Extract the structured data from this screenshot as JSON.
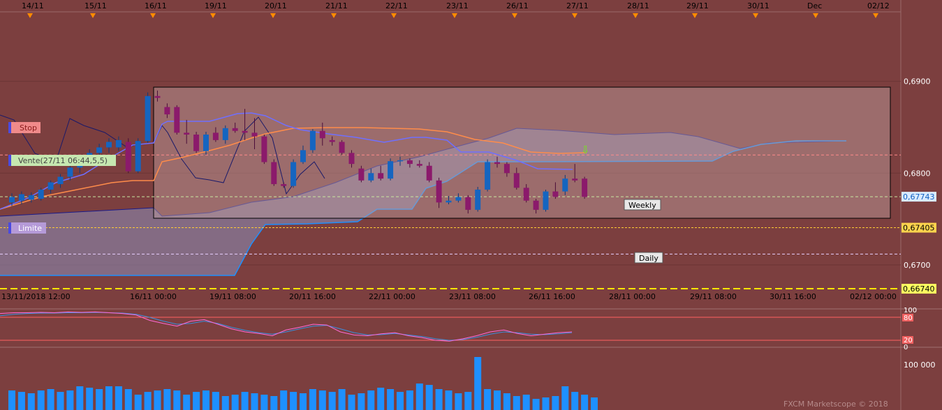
{
  "colors": {
    "background": "#7c3f3f",
    "axis_panel": "#7c3f3f",
    "grid": "#6a3434",
    "bull_candle": "#1565c0",
    "bear_candle": "#8b1a6b",
    "tenkan": "#6f6fff",
    "kijun": "#ff8c4a",
    "senkou_span": "#1e90ff",
    "cloud_fill": "#8a90bb",
    "stop_line": "#ff8a8a",
    "stoch_k": "#ff6ad5",
    "stoch_d": "#3a8fe0",
    "volume": "#1e90ff",
    "weekly_box": "#c4a3a3",
    "yellow_line": "#ffe600"
  },
  "top_dates": [
    "14/11",
    "15/11",
    "16/11",
    "19/11",
    "20/11",
    "21/11",
    "22/11",
    "23/11",
    "26/11",
    "27/11",
    "28/11",
    "29/11",
    "30/11",
    "Dec",
    "02/12"
  ],
  "bottom_dates": [
    "13/11/2018 12:00",
    "16/11 00:00",
    "19/11 08:00",
    "20/11 16:00",
    "22/11 00:00",
    "23/11 08:00",
    "26/11 16:00",
    "28/11 00:00",
    "29/11 08:00",
    "30/11 16:00",
    "02/12 00:00"
  ],
  "price_axis": {
    "ticks": [
      "0,6900",
      "0,6800",
      "0,6700"
    ],
    "tags": [
      {
        "label": "0,67743",
        "value": 0.67743,
        "kind": "current"
      },
      {
        "label": "0,67405",
        "value": 0.67405,
        "kind": "weekly"
      },
      {
        "label": "0,66740",
        "value": 0.6674,
        "kind": "daily"
      }
    ]
  },
  "annotations": {
    "stop": "Stop",
    "vente": "Vente(27/11 06:44,5,5)",
    "limite": "Limite",
    "weekly": "Weekly",
    "daily": "Daily"
  },
  "osc_axis": [
    "100",
    "80",
    "20",
    "0"
  ],
  "vol_axis": [
    "100 000"
  ],
  "watermark": "FXCM Marketscope © 2018",
  "chart_data": {
    "type": "candlestick",
    "ylim": [
      0.6652,
      0.6975
    ],
    "levels": {
      "stop": 0.68198,
      "entry": 0.67743,
      "weekly": 0.67405,
      "limit": 0.67118,
      "daily": 0.6674
    },
    "candles": [
      [
        0.6768,
        0.6774,
        0.6764,
        0.6778
      ],
      [
        0.677,
        0.6777,
        0.6766,
        0.678
      ],
      [
        0.6771,
        0.6776,
        0.6768,
        0.6779
      ],
      [
        0.6772,
        0.6782,
        0.677,
        0.6784
      ],
      [
        0.6782,
        0.679,
        0.6778,
        0.6792
      ],
      [
        0.6788,
        0.6796,
        0.6784,
        0.6799
      ],
      [
        0.6796,
        0.6806,
        0.6792,
        0.681
      ],
      [
        0.6806,
        0.6813,
        0.68,
        0.6816
      ],
      [
        0.6813,
        0.6822,
        0.6808,
        0.6826
      ],
      [
        0.6822,
        0.6828,
        0.6816,
        0.6832
      ],
      [
        0.6828,
        0.6834,
        0.6822,
        0.6838
      ],
      [
        0.6828,
        0.6836,
        0.6824,
        0.684
      ],
      [
        0.6834,
        0.6802,
        0.68,
        0.6838
      ],
      [
        0.6802,
        0.6835,
        0.68,
        0.6838
      ],
      [
        0.6835,
        0.6884,
        0.6833,
        0.6888
      ],
      [
        0.6884,
        0.6882,
        0.6878,
        0.689
      ],
      [
        0.6872,
        0.6864,
        0.686,
        0.6876
      ],
      [
        0.6872,
        0.6844,
        0.6842,
        0.6874
      ],
      [
        0.6844,
        0.6842,
        0.6832,
        0.6858
      ],
      [
        0.6842,
        0.6824,
        0.6822,
        0.6845
      ],
      [
        0.6824,
        0.6842,
        0.682,
        0.6845
      ],
      [
        0.6844,
        0.6836,
        0.6834,
        0.685
      ],
      [
        0.6836,
        0.6849,
        0.6832,
        0.6852
      ],
      [
        0.6849,
        0.6846,
        0.6844,
        0.6855
      ],
      [
        0.6846,
        0.6844,
        0.6836,
        0.687
      ],
      [
        0.6844,
        0.684,
        0.6826,
        0.686
      ],
      [
        0.684,
        0.6812,
        0.681,
        0.6842
      ],
      [
        0.6812,
        0.6788,
        0.6786,
        0.6815
      ],
      [
        0.6788,
        0.6786,
        0.6784,
        0.679
      ],
      [
        0.6786,
        0.6812,
        0.6784,
        0.6815
      ],
      [
        0.6812,
        0.6825,
        0.681,
        0.683
      ],
      [
        0.6825,
        0.6846,
        0.6822,
        0.6848
      ],
      [
        0.6846,
        0.6838,
        0.683,
        0.6855
      ],
      [
        0.6836,
        0.6834,
        0.683,
        0.684
      ],
      [
        0.6834,
        0.6822,
        0.682,
        0.6836
      ],
      [
        0.6822,
        0.681,
        0.6806,
        0.6825
      ],
      [
        0.6805,
        0.6792,
        0.679,
        0.6808
      ],
      [
        0.6792,
        0.68,
        0.679,
        0.6805
      ],
      [
        0.68,
        0.6794,
        0.6792,
        0.6808
      ],
      [
        0.6794,
        0.6813,
        0.6792,
        0.6816
      ],
      [
        0.6813,
        0.6814,
        0.6808,
        0.6818
      ],
      [
        0.6814,
        0.681,
        0.6806,
        0.6816
      ],
      [
        0.681,
        0.6808,
        0.6806,
        0.6814
      ],
      [
        0.6808,
        0.6792,
        0.679,
        0.6812
      ],
      [
        0.6792,
        0.6768,
        0.6762,
        0.6795
      ],
      [
        0.6768,
        0.677,
        0.6766,
        0.6775
      ],
      [
        0.677,
        0.6774,
        0.6768,
        0.6778
      ],
      [
        0.6774,
        0.676,
        0.6756,
        0.6776
      ],
      [
        0.676,
        0.6782,
        0.6758,
        0.6785
      ],
      [
        0.6782,
        0.6812,
        0.678,
        0.6815
      ],
      [
        0.6812,
        0.681,
        0.6806,
        0.6818
      ],
      [
        0.681,
        0.68,
        0.6796,
        0.6812
      ],
      [
        0.68,
        0.6784,
        0.6782,
        0.6806
      ],
      [
        0.6784,
        0.677,
        0.6768,
        0.6788
      ],
      [
        0.677,
        0.676,
        0.6756,
        0.6772
      ],
      [
        0.676,
        0.678,
        0.6758,
        0.6782
      ],
      [
        0.678,
        0.6774,
        0.6772,
        0.679
      ],
      [
        0.678,
        0.6794,
        0.6776,
        0.6798
      ],
      [
        0.6794,
        0.6792,
        0.679,
        0.681
      ],
      [
        0.6794,
        0.6774,
        0.6772,
        0.6796
      ]
    ]
  }
}
